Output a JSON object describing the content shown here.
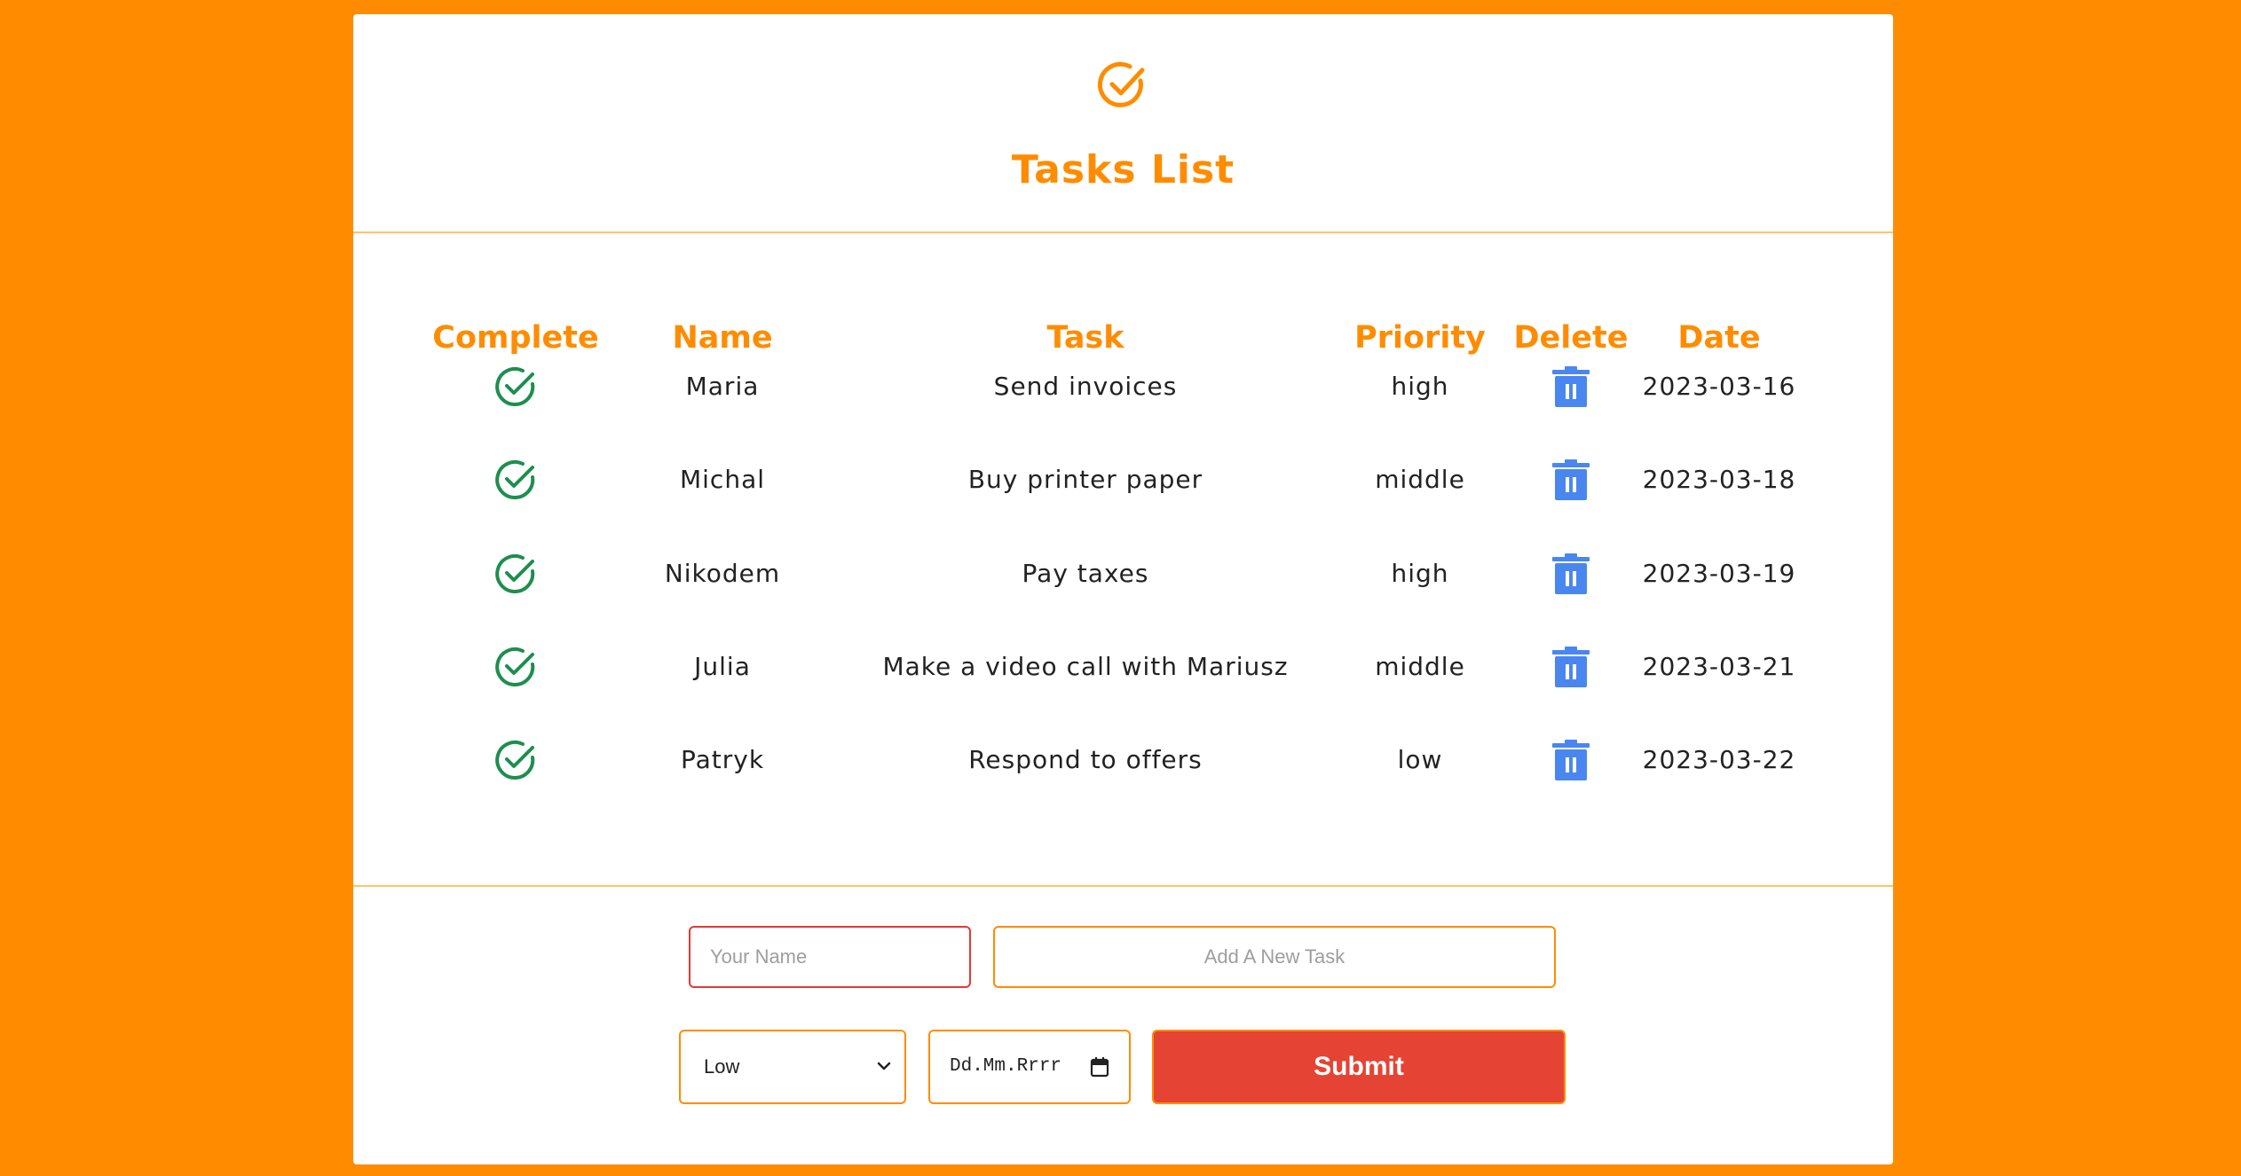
{
  "header": {
    "title": "Tasks List",
    "icon": "check-circle-icon",
    "accent": "#ff8c00"
  },
  "table": {
    "columns": {
      "complete": "Complete",
      "name": "Name",
      "task": "Task",
      "priority": "Priority",
      "delete": "Delete",
      "date": "Date"
    },
    "rows": [
      {
        "name": "Maria",
        "task": "Send invoices",
        "priority": "high",
        "date": "2023-03-16"
      },
      {
        "name": "Michal",
        "task": "Buy printer paper",
        "priority": "middle",
        "date": "2023-03-18"
      },
      {
        "name": "Nikodem",
        "task": "Pay taxes",
        "priority": "high",
        "date": "2023-03-19"
      },
      {
        "name": "Julia",
        "task": "Make a video call with Mariusz",
        "priority": "middle",
        "date": "2023-03-21"
      },
      {
        "name": "Patryk",
        "task": "Respond to offers",
        "priority": "low",
        "date": "2023-03-22"
      }
    ],
    "complete_icon": "check-circle-icon",
    "complete_color": "#1e8e4e",
    "delete_icon": "trash-icon",
    "delete_color": "#4a86f0"
  },
  "form": {
    "name_placeholder": "Your Name",
    "task_placeholder": "Add A New Task",
    "priority_selected": "Low",
    "date_placeholder": "Dd.Mm.Rrrr",
    "submit_label": "Submit",
    "submit_color": "#e54333"
  }
}
